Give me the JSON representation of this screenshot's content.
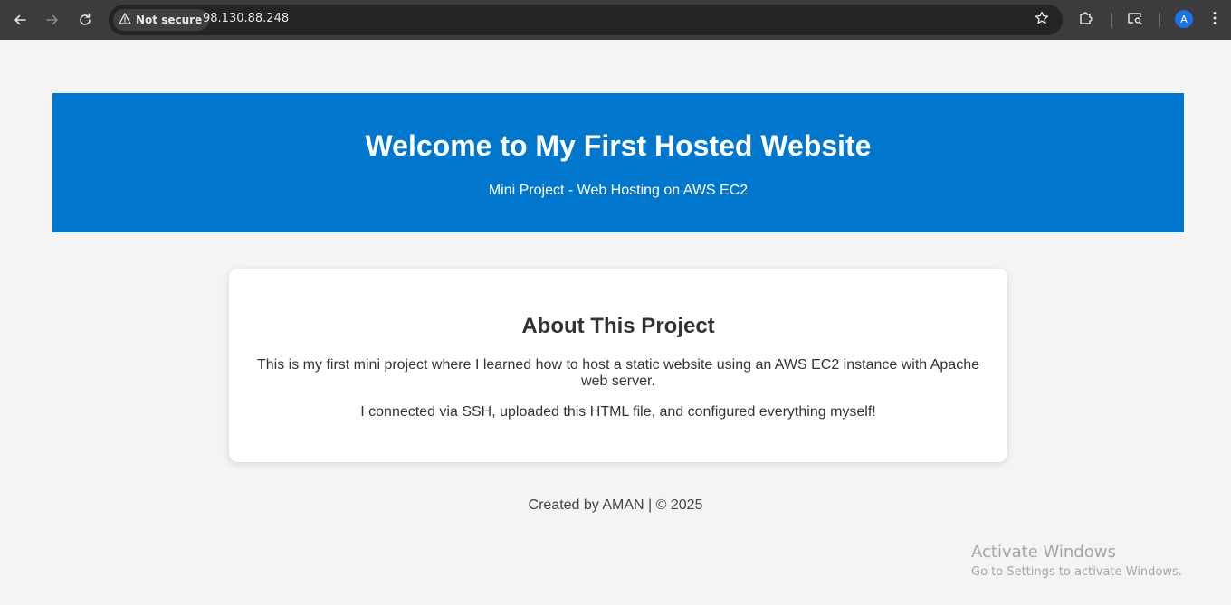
{
  "browser": {
    "security_label": "Not secure",
    "url": "98.130.88.248",
    "profile_initial": "A",
    "icons": {
      "back": "arrow-left-icon",
      "forward": "arrow-right-icon",
      "reload": "reload-icon",
      "warning": "warning-triangle-icon",
      "bookmark": "star-icon",
      "extensions": "puzzle-icon",
      "tab_search": "tab-search-icon",
      "menu": "kebab-menu-icon"
    },
    "colors": {
      "toolbar": "#3c3c3c",
      "omnibox": "#242424",
      "avatar": "#1a73e8"
    }
  },
  "page": {
    "header": {
      "title": "Welcome to My First Hosted Website",
      "subtitle": "Mini Project - Web Hosting on AWS EC2",
      "background": "#0077cc"
    },
    "about": {
      "heading": "About This Project",
      "paragraph1": "This is my first mini project where I learned how to host a static website using an AWS EC2 instance with Apache web server.",
      "paragraph2": "I connected via SSH, uploaded this HTML file, and configured everything myself!"
    },
    "footer": {
      "text": "Created by AMAN | © 2025"
    }
  },
  "os_watermark": {
    "line1": "Activate Windows",
    "line2": "Go to Settings to activate Windows."
  }
}
